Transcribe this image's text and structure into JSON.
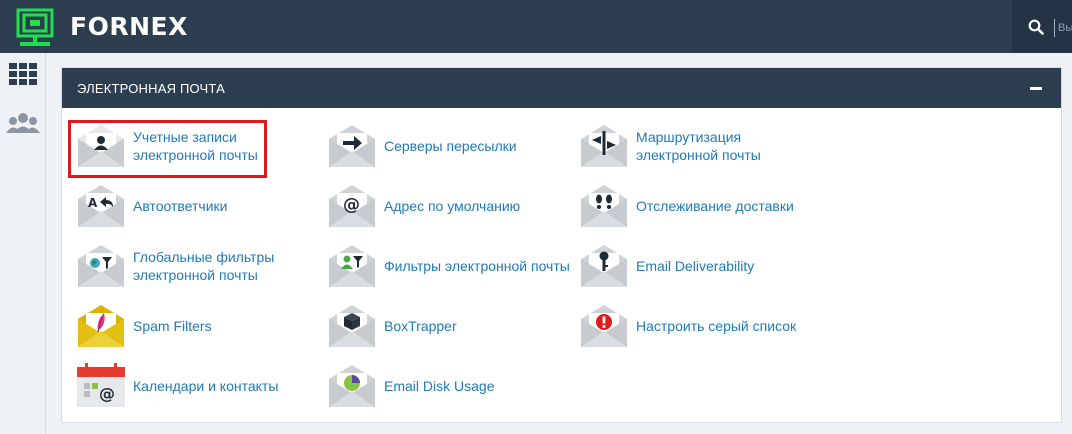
{
  "header": {
    "brand": "FORNEX",
    "brand_color": "#1fe04a",
    "search_placeholder": "Вы"
  },
  "sidebar": {
    "items": [
      {
        "icon": "grid-icon"
      },
      {
        "icon": "users-icon"
      }
    ]
  },
  "panel": {
    "title": "ЭЛЕКТРОННАЯ ПОЧТА",
    "collapse_symbol": "minus-icon"
  },
  "items": {
    "accounts": {
      "label": "Учетные записи\nэлектронной почты",
      "icon": "user-envelope-icon",
      "highlighted": true
    },
    "forwarders": {
      "label": "Серверы пересылки",
      "icon": "arrow-envelope-icon"
    },
    "routing": {
      "label": "Маршрутизация\nэлектронной почты",
      "icon": "signpost-envelope-icon"
    },
    "autoresponders": {
      "label": "Автоответчики",
      "icon": "reply-envelope-icon"
    },
    "default_address": {
      "label": "Адрес по умолчанию",
      "icon": "at-envelope-icon"
    },
    "tracking": {
      "label": "Отслеживание доставки",
      "icon": "footprints-envelope-icon"
    },
    "global_filters": {
      "label": "Глобальные фильтры\nэлектронной почты",
      "icon": "globe-filter-envelope-icon"
    },
    "filters": {
      "label": "Фильтры электронной почты",
      "icon": "user-filter-envelope-icon"
    },
    "deliverability": {
      "label": "Email Deliverability",
      "icon": "key-envelope-icon"
    },
    "spam_filters": {
      "label": "Spam Filters",
      "icon": "feather-envelope-icon"
    },
    "boxtrapper": {
      "label": "BoxTrapper",
      "icon": "box-envelope-icon"
    },
    "greylisting": {
      "label": "Настроить серый список",
      "icon": "alert-envelope-icon"
    },
    "calendars": {
      "label": "Календари и контакты",
      "icon": "calendar-icon"
    },
    "disk_usage": {
      "label": "Email Disk Usage",
      "icon": "pie-envelope-icon"
    }
  }
}
